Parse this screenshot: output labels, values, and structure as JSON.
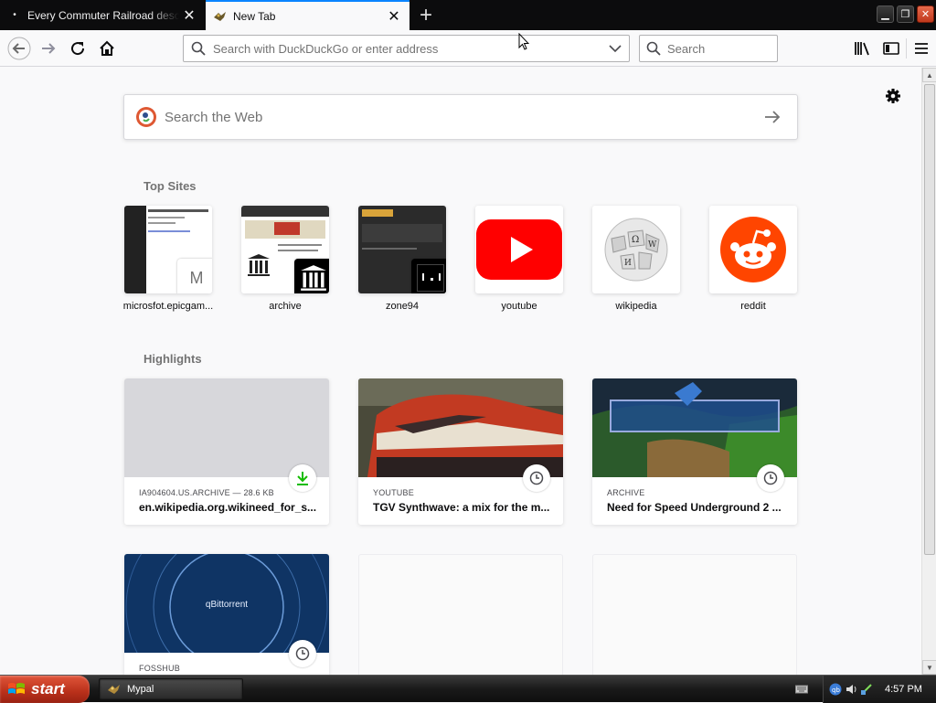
{
  "tabs": [
    {
      "title": "Every Commuter Railroad describ",
      "active": false
    },
    {
      "title": "New Tab",
      "active": true
    }
  ],
  "navbar": {
    "url_placeholder": "Search with DuckDuckGo or enter address",
    "search_placeholder": "Search"
  },
  "page": {
    "websearch_placeholder": "Search the Web",
    "top_sites_title": "Top Sites",
    "highlights_title": "Highlights",
    "top_sites": [
      {
        "label": "microsfot.epicgam...",
        "badge": "M"
      },
      {
        "label": "archive"
      },
      {
        "label": "zone94"
      },
      {
        "label": "youtube"
      },
      {
        "label": "wikipedia"
      },
      {
        "label": "reddit"
      }
    ],
    "highlights": [
      {
        "source": "IA904604.US.ARCHIVE — 28.6 KB",
        "title": "en.wikipedia.org.wikineed_for_s...",
        "badge": "download-icon"
      },
      {
        "source": "YOUTUBE",
        "title": "TGV Synthwave: a mix for the m...",
        "badge": "clock-icon"
      },
      {
        "source": "ARCHIVE",
        "title": "Need for Speed Underground 2 ...",
        "badge": "clock-icon"
      },
      {
        "source": "FOSSHUB",
        "title": "",
        "badge": "clock-icon",
        "image_text": "qBittorrent"
      }
    ]
  },
  "taskbar": {
    "start_label": "start",
    "task_label": "Mypal",
    "clock": "4:57 PM"
  },
  "colors": {
    "accent": "#0a84ff",
    "youtube_red": "#ff0000",
    "reddit_orange": "#ff4500",
    "start_red": "#c0391d"
  }
}
